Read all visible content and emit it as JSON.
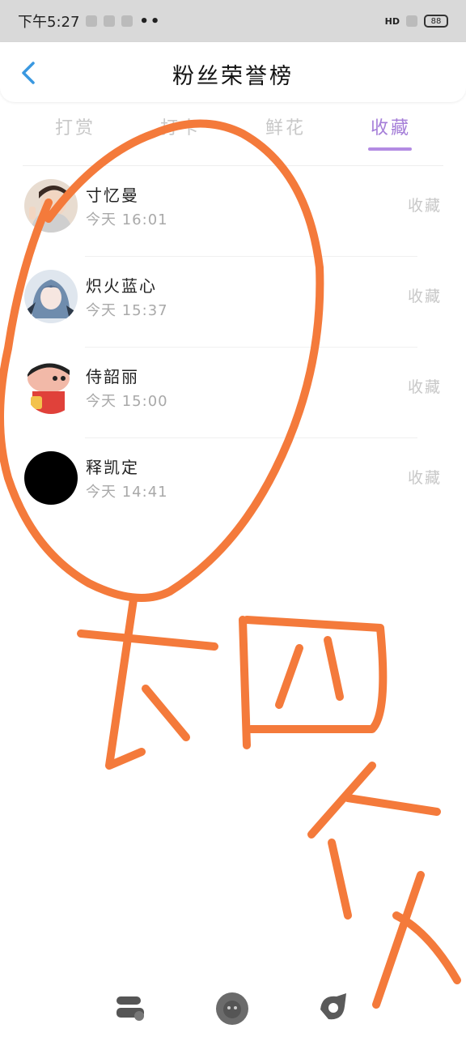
{
  "status_bar": {
    "time": "下午5:27",
    "dots": "••",
    "network": "HD",
    "battery": "88"
  },
  "header": {
    "title": "粉丝荣誉榜"
  },
  "tabs": [
    {
      "label": "打赏",
      "active": false
    },
    {
      "label": "打卡",
      "active": false
    },
    {
      "label": "鲜花",
      "active": false
    },
    {
      "label": "收藏",
      "active": true
    }
  ],
  "rows": [
    {
      "name": "寸忆曼",
      "time": "今天 16:01",
      "action": "收藏"
    },
    {
      "name": "炽火蓝心",
      "time": "今天 15:37",
      "action": "收藏"
    },
    {
      "name": "侍韶丽",
      "time": "今天 15:00",
      "action": "收藏"
    },
    {
      "name": "释凯定",
      "time": "今天 14:41",
      "action": "收藏"
    }
  ],
  "colors": {
    "accent": "#a57ed8",
    "annotation": "#f47a3b",
    "status_bg": "#d9d9d9"
  },
  "icons": {
    "back": "chevron-left-icon",
    "dock": [
      "dock-app-icon",
      "dock-lion-icon",
      "dock-shape-icon"
    ]
  }
}
